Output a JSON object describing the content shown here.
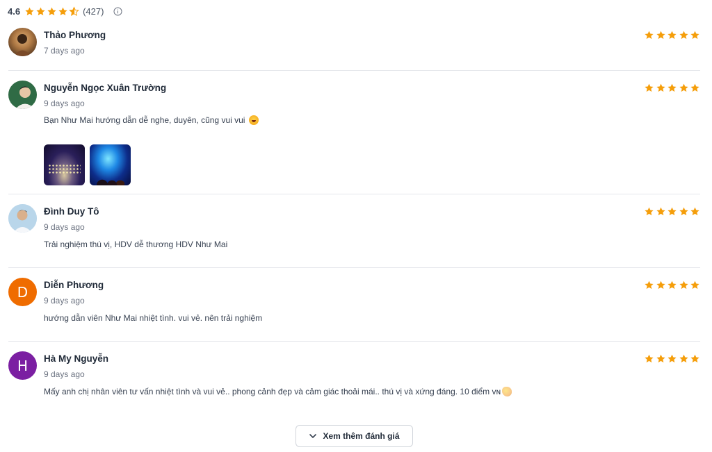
{
  "summary": {
    "average": "4.6",
    "count": "(427)",
    "stars": 4.6,
    "star_color": "#f59e0b",
    "info_icon": "info-icon"
  },
  "reviews": [
    {
      "name": "Thảo Phương",
      "date": "7 days ago",
      "text": "",
      "rating": 5,
      "avatar": {
        "type": "photo",
        "colors": [
          "#8b5a2b",
          "#d9a35f"
        ]
      }
    },
    {
      "name": "Nguyễn Ngọc Xuân Trường",
      "date": "9 days ago",
      "text": "Bạn Như Mai hướng dẫn dễ nghe, duyên, cũng vui vui",
      "emoji": "rolling-on-floor-laughing-emoji",
      "rating": 5,
      "avatar": {
        "type": "photo",
        "colors": [
          "#2e7d4f",
          "#e8e2d6"
        ]
      },
      "photos": [
        "night-light-garden-photo",
        "blue-projection-photo"
      ]
    },
    {
      "name": "Đình Duy Tô",
      "date": "9 days ago",
      "text": "Trải nghiệm thú vị, HDV dễ thương HDV Như Mai",
      "rating": 5,
      "avatar": {
        "type": "photo",
        "colors": [
          "#9fc4dd",
          "#f1f5f9"
        ]
      }
    },
    {
      "name": "Diễn Phương",
      "date": "9 days ago",
      "text": "hướng dẫn viên Như Mai nhiệt tình. vui vẻ. nên trải nghiệm",
      "rating": 5,
      "avatar": {
        "type": "letter",
        "letter": "D",
        "color": "#ef6c00"
      }
    },
    {
      "name": "Hà My Nguyễn",
      "date": "9 days ago",
      "text": "Mấy anh chị nhân viên tư vấn nhiệt tình và vui vẻ.. phong cảnh đẹp và cảm giác thoải mái.. thú vị và xứng đáng. 10 điểm ᴠɴ",
      "emoji": "clapping-hands-emoji",
      "rating": 5,
      "avatar": {
        "type": "letter",
        "letter": "H",
        "color": "#7b1fa2"
      }
    }
  ],
  "more_button": {
    "label": "Xem thêm đánh giá",
    "icon": "chevron-down-icon"
  }
}
